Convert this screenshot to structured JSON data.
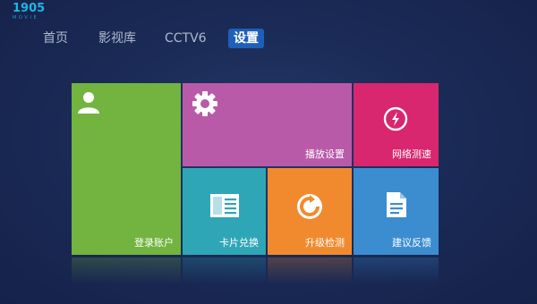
{
  "app": {
    "logo_text": "1905",
    "logo_sub": "M O V I E"
  },
  "nav": {
    "tabs": [
      {
        "label": "首页",
        "active": false
      },
      {
        "label": "影视库",
        "active": false
      },
      {
        "label": "CCTV6",
        "active": false
      },
      {
        "label": "设置",
        "active": true
      }
    ]
  },
  "tiles": {
    "account": {
      "label": "登录账户",
      "icon": "user-icon",
      "color": "#72b43f"
    },
    "playback": {
      "label": "播放设置",
      "icon": "gear-icon",
      "color": "#b95aa8"
    },
    "network": {
      "label": "网络测速",
      "icon": "speed-icon",
      "color": "#d8266f"
    },
    "card": {
      "label": "卡片兑换",
      "icon": "card-icon",
      "color": "#2fa6b6"
    },
    "upgrade": {
      "label": "升级检测",
      "icon": "refresh-icon",
      "color": "#f18a2f"
    },
    "feedback": {
      "label": "建议反馈",
      "icon": "document-icon",
      "color": "#3b8dd0"
    }
  }
}
